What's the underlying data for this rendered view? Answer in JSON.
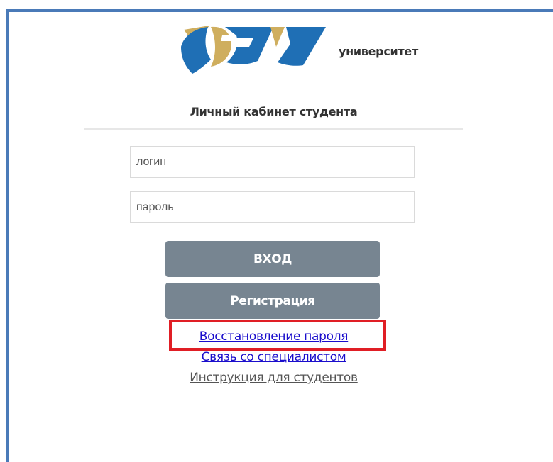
{
  "header": {
    "logo_caption": "университет"
  },
  "card": {
    "title": "Личный кабинет студента"
  },
  "form": {
    "login_placeholder": "логин",
    "password_placeholder": "пароль",
    "login_button": "ВХОД",
    "register_button": "Регистрация"
  },
  "links": {
    "password_recovery": "Восстановление пароля",
    "contact_specialist": "Связь со специалистом",
    "student_instructions": "Инструкция для студентов"
  },
  "colors": {
    "frame_border": "#4a7ab8",
    "button_bg": "#778591",
    "link_blue": "#1a0dcc",
    "highlight_red": "#e01e25",
    "logo_blue": "#1f6fb5",
    "logo_gold": "#cfae5e"
  }
}
